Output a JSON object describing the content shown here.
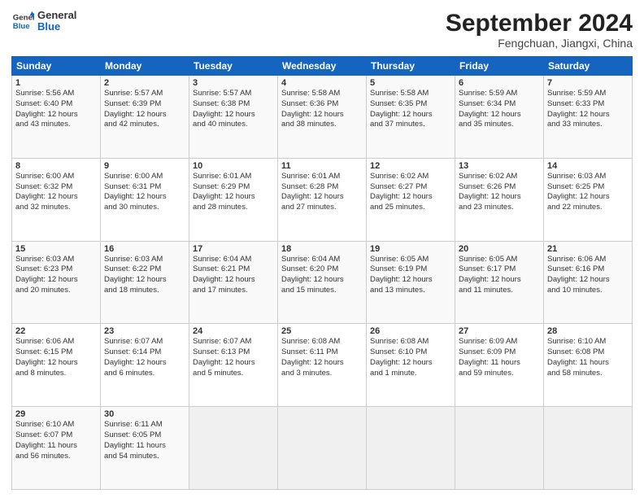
{
  "header": {
    "logo_line1": "General",
    "logo_line2": "Blue",
    "month": "September 2024",
    "location": "Fengchuan, Jiangxi, China"
  },
  "weekdays": [
    "Sunday",
    "Monday",
    "Tuesday",
    "Wednesday",
    "Thursday",
    "Friday",
    "Saturday"
  ],
  "weeks": [
    [
      {
        "day": 1,
        "lines": [
          "Sunrise: 5:56 AM",
          "Sunset: 6:40 PM",
          "Daylight: 12 hours",
          "and 43 minutes."
        ]
      },
      {
        "day": 2,
        "lines": [
          "Sunrise: 5:57 AM",
          "Sunset: 6:39 PM",
          "Daylight: 12 hours",
          "and 42 minutes."
        ]
      },
      {
        "day": 3,
        "lines": [
          "Sunrise: 5:57 AM",
          "Sunset: 6:38 PM",
          "Daylight: 12 hours",
          "and 40 minutes."
        ]
      },
      {
        "day": 4,
        "lines": [
          "Sunrise: 5:58 AM",
          "Sunset: 6:36 PM",
          "Daylight: 12 hours",
          "and 38 minutes."
        ]
      },
      {
        "day": 5,
        "lines": [
          "Sunrise: 5:58 AM",
          "Sunset: 6:35 PM",
          "Daylight: 12 hours",
          "and 37 minutes."
        ]
      },
      {
        "day": 6,
        "lines": [
          "Sunrise: 5:59 AM",
          "Sunset: 6:34 PM",
          "Daylight: 12 hours",
          "and 35 minutes."
        ]
      },
      {
        "day": 7,
        "lines": [
          "Sunrise: 5:59 AM",
          "Sunset: 6:33 PM",
          "Daylight: 12 hours",
          "and 33 minutes."
        ]
      }
    ],
    [
      {
        "day": 8,
        "lines": [
          "Sunrise: 6:00 AM",
          "Sunset: 6:32 PM",
          "Daylight: 12 hours",
          "and 32 minutes."
        ]
      },
      {
        "day": 9,
        "lines": [
          "Sunrise: 6:00 AM",
          "Sunset: 6:31 PM",
          "Daylight: 12 hours",
          "and 30 minutes."
        ]
      },
      {
        "day": 10,
        "lines": [
          "Sunrise: 6:01 AM",
          "Sunset: 6:29 PM",
          "Daylight: 12 hours",
          "and 28 minutes."
        ]
      },
      {
        "day": 11,
        "lines": [
          "Sunrise: 6:01 AM",
          "Sunset: 6:28 PM",
          "Daylight: 12 hours",
          "and 27 minutes."
        ]
      },
      {
        "day": 12,
        "lines": [
          "Sunrise: 6:02 AM",
          "Sunset: 6:27 PM",
          "Daylight: 12 hours",
          "and 25 minutes."
        ]
      },
      {
        "day": 13,
        "lines": [
          "Sunrise: 6:02 AM",
          "Sunset: 6:26 PM",
          "Daylight: 12 hours",
          "and 23 minutes."
        ]
      },
      {
        "day": 14,
        "lines": [
          "Sunrise: 6:03 AM",
          "Sunset: 6:25 PM",
          "Daylight: 12 hours",
          "and 22 minutes."
        ]
      }
    ],
    [
      {
        "day": 15,
        "lines": [
          "Sunrise: 6:03 AM",
          "Sunset: 6:23 PM",
          "Daylight: 12 hours",
          "and 20 minutes."
        ]
      },
      {
        "day": 16,
        "lines": [
          "Sunrise: 6:03 AM",
          "Sunset: 6:22 PM",
          "Daylight: 12 hours",
          "and 18 minutes."
        ]
      },
      {
        "day": 17,
        "lines": [
          "Sunrise: 6:04 AM",
          "Sunset: 6:21 PM",
          "Daylight: 12 hours",
          "and 17 minutes."
        ]
      },
      {
        "day": 18,
        "lines": [
          "Sunrise: 6:04 AM",
          "Sunset: 6:20 PM",
          "Daylight: 12 hours",
          "and 15 minutes."
        ]
      },
      {
        "day": 19,
        "lines": [
          "Sunrise: 6:05 AM",
          "Sunset: 6:19 PM",
          "Daylight: 12 hours",
          "and 13 minutes."
        ]
      },
      {
        "day": 20,
        "lines": [
          "Sunrise: 6:05 AM",
          "Sunset: 6:17 PM",
          "Daylight: 12 hours",
          "and 11 minutes."
        ]
      },
      {
        "day": 21,
        "lines": [
          "Sunrise: 6:06 AM",
          "Sunset: 6:16 PM",
          "Daylight: 12 hours",
          "and 10 minutes."
        ]
      }
    ],
    [
      {
        "day": 22,
        "lines": [
          "Sunrise: 6:06 AM",
          "Sunset: 6:15 PM",
          "Daylight: 12 hours",
          "and 8 minutes."
        ]
      },
      {
        "day": 23,
        "lines": [
          "Sunrise: 6:07 AM",
          "Sunset: 6:14 PM",
          "Daylight: 12 hours",
          "and 6 minutes."
        ]
      },
      {
        "day": 24,
        "lines": [
          "Sunrise: 6:07 AM",
          "Sunset: 6:13 PM",
          "Daylight: 12 hours",
          "and 5 minutes."
        ]
      },
      {
        "day": 25,
        "lines": [
          "Sunrise: 6:08 AM",
          "Sunset: 6:11 PM",
          "Daylight: 12 hours",
          "and 3 minutes."
        ]
      },
      {
        "day": 26,
        "lines": [
          "Sunrise: 6:08 AM",
          "Sunset: 6:10 PM",
          "Daylight: 12 hours",
          "and 1 minute."
        ]
      },
      {
        "day": 27,
        "lines": [
          "Sunrise: 6:09 AM",
          "Sunset: 6:09 PM",
          "Daylight: 11 hours",
          "and 59 minutes."
        ]
      },
      {
        "day": 28,
        "lines": [
          "Sunrise: 6:10 AM",
          "Sunset: 6:08 PM",
          "Daylight: 11 hours",
          "and 58 minutes."
        ]
      }
    ],
    [
      {
        "day": 29,
        "lines": [
          "Sunrise: 6:10 AM",
          "Sunset: 6:07 PM",
          "Daylight: 11 hours",
          "and 56 minutes."
        ]
      },
      {
        "day": 30,
        "lines": [
          "Sunrise: 6:11 AM",
          "Sunset: 6:05 PM",
          "Daylight: 11 hours",
          "and 54 minutes."
        ]
      },
      null,
      null,
      null,
      null,
      null
    ]
  ]
}
